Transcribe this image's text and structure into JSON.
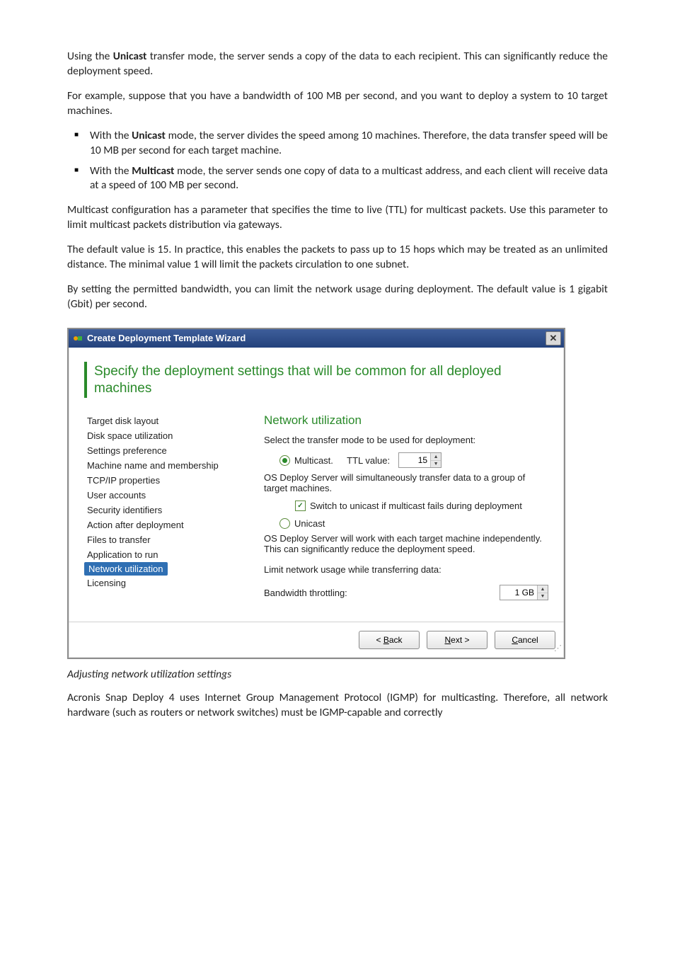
{
  "doc": {
    "p1": "Using the Unicast transfer mode, the server sends a copy of the data to each recipient. This can significantly reduce the deployment speed.",
    "p2": "For example, suppose that you have a bandwidth of 100 MB per second, and you want to deploy a system to 10 target machines.",
    "li1": "With the Unicast mode, the server divides the speed among 10 machines. Therefore, the data transfer speed will be 10 MB per second for each target machine.",
    "li2": "With the Multicast mode, the server sends one copy of data to a multicast address, and each client will receive data at a speed of 100 MB per second.",
    "p3": "Multicast configuration has a parameter that specifies the time to live (TTL) for multicast packets. Use this parameter to limit multicast packets distribution via gateways.",
    "p4": "The default value is 15. In practice, this enables the packets to pass up to 15 hops which may be treated as an unlimited distance. The minimal value 1 will limit the packets circulation to one subnet.",
    "p5": "By setting the permitted bandwidth, you can limit the network usage during deployment. The default value is 1 gigabit (Gbit) per second.",
    "caption": "Adjusting network utilization settings",
    "p6": "Acronis Snap Deploy 4 uses Internet Group Management Protocol (IGMP) for multicasting. Therefore, all network hardware (such as routers or network switches) must be IGMP-capable and correctly"
  },
  "dialog": {
    "title": "Create Deployment Template Wizard",
    "heading": "Specify the deployment settings that will be common for all deployed machines",
    "side": {
      "items": [
        "Target disk layout",
        "Disk space utilization",
        "Settings preference",
        "Machine name and membership",
        "TCP/IP properties",
        "User accounts",
        "Security identifiers",
        "Action after deployment",
        "Files to transfer",
        "Application to run",
        "Network utilization",
        "Licensing"
      ],
      "selected_index": 10
    },
    "panel": {
      "title": "Network utilization",
      "select_prompt": "Select the transfer mode to be used for deployment:",
      "multicast": {
        "label": "Multicast.",
        "ttl_label": "TTL value:",
        "ttl_value": "15",
        "desc": "OS Deploy Server will simultaneously transfer data to a group of target machines.",
        "switch_label": "Switch to unicast if multicast fails during deployment",
        "switch_checked": true,
        "checked": true
      },
      "unicast": {
        "label": "Unicast",
        "desc": "OS Deploy Server will work with each target machine independently. This can significantly reduce the deployment speed.",
        "checked": false
      },
      "limit_label": "Limit network usage while transferring data:",
      "bandwidth_label": "Bandwidth throttling:",
      "bandwidth_value": "1 GB"
    },
    "buttons": {
      "back": "< Back",
      "next": "Next >",
      "cancel": "Cancel"
    }
  }
}
